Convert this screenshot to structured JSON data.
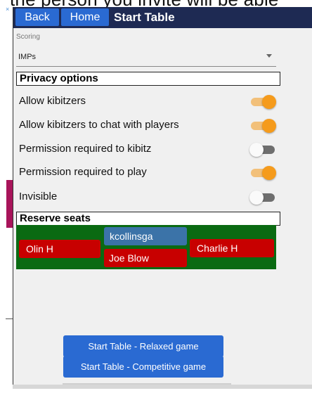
{
  "background": {
    "partial_text": "the person you invite will be able",
    "close_glyph": "×"
  },
  "header": {
    "back_label": "Back",
    "home_label": "Home",
    "title": "Start Table",
    "bg_color": "#1e2a53",
    "button_color": "#2a6ad2"
  },
  "scoring": {
    "label": "Scoring",
    "value": "IMPs"
  },
  "privacy": {
    "title": "Privacy options",
    "options": [
      {
        "label": "Allow kibitzers",
        "enabled": true
      },
      {
        "label": "Allow kibitzers to chat with players",
        "enabled": true
      },
      {
        "label": "Permission required to kibitz",
        "enabled": false
      },
      {
        "label": "Permission required to play",
        "enabled": true
      },
      {
        "label": "Invisible",
        "enabled": false
      }
    ]
  },
  "reserve": {
    "title": "Reserve seats",
    "seats": {
      "west": "Olin H",
      "north": "kcollinsga",
      "south": "Joe Blow",
      "east": "Charlie H"
    },
    "table_color": "#0a6a12",
    "reserved_color": "#c80000",
    "self_color": "#3b73a8"
  },
  "actions": {
    "relaxed_label": "Start Table - Relaxed game",
    "competitive_label": "Start Table - Competitive game"
  },
  "colors": {
    "toggle_on": "#f59b1c",
    "toggle_off": "#6e6e6e"
  }
}
